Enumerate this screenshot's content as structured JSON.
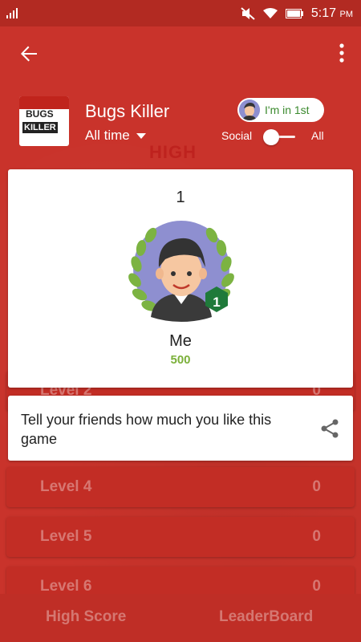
{
  "status_bar": {
    "time": "5:17",
    "time_suffix": "PM"
  },
  "game": {
    "icon_text_top": "BUGS",
    "icon_text_bottom": "KILLER",
    "title": "Bugs Killer",
    "time_filter": "All time",
    "rank_chip_label": "I'm in 1st",
    "toggle_left_label": "Social",
    "toggle_right_label": "All",
    "faded_banner": "HIGH"
  },
  "player_card": {
    "rank": "1",
    "badge_rank": "1",
    "name": "Me",
    "score": "500"
  },
  "share": {
    "text": "Tell your friends how much you like this game"
  },
  "background_rows": [
    {
      "label": "Level 2",
      "score": "0"
    },
    {
      "label": "Level 4",
      "score": "0"
    },
    {
      "label": "Level 5",
      "score": "0"
    },
    {
      "label": "Level 6",
      "score": "0"
    }
  ],
  "bottom_tabs": {
    "high_score": "High Score",
    "leaderboard": "LeaderBoard"
  },
  "colors": {
    "primary": "#c9332b",
    "accent_green": "#3b8a2e",
    "score_green": "#7bb03a",
    "badge_green": "#1f7a3a"
  }
}
